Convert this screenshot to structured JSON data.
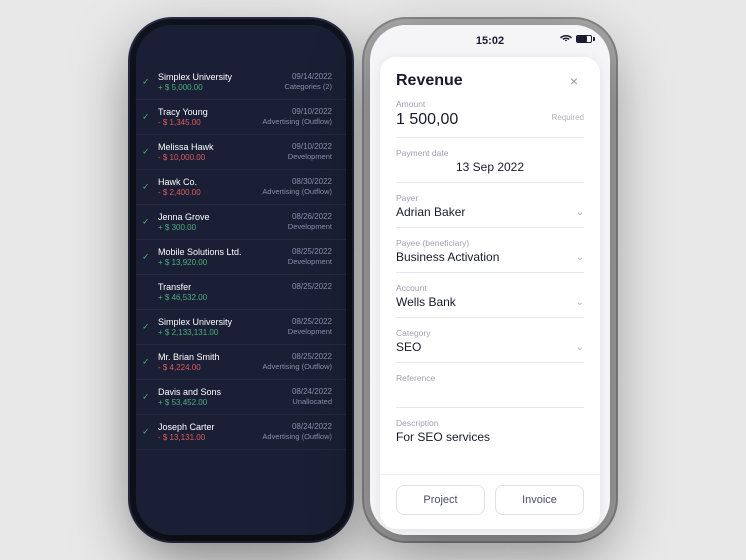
{
  "scene": {
    "bg_color": "#e0e0e4"
  },
  "left_phone": {
    "transactions": [
      {
        "name": "Simplex University",
        "amount": "+ $ 5,000.00",
        "positive": true,
        "date": "09/14/2022",
        "category": "Categories (2)",
        "checked": true
      },
      {
        "name": "Tracy Young",
        "amount": "- $ 1,345.00",
        "positive": false,
        "date": "09/10/2022",
        "category": "Advertising (Outflow)",
        "checked": true
      },
      {
        "name": "Melissa Hawk",
        "amount": "- $ 10,000.00",
        "positive": false,
        "date": "09/10/2022",
        "category": "Development",
        "checked": true
      },
      {
        "name": "Hawk Co.",
        "amount": "- $ 2,400.00",
        "positive": false,
        "date": "08/30/2022",
        "category": "Advertising (Outflow)",
        "checked": true
      },
      {
        "name": "Jenna Grove",
        "amount": "+ $ 300.00",
        "positive": true,
        "date": "08/26/2022",
        "category": "Development",
        "checked": true
      },
      {
        "name": "Mobile Solutions Ltd.",
        "amount": "+ $ 13,920.00",
        "positive": true,
        "date": "08/25/2022",
        "category": "Development",
        "checked": true
      },
      {
        "name": "Transfer",
        "amount": "+ $ 46,532.00",
        "positive": true,
        "date": "08/25/2022",
        "category": "",
        "checked": false
      },
      {
        "name": "Simplex University",
        "amount": "+ $ 2,133,131.00",
        "positive": true,
        "date": "08/25/2022",
        "category": "Development",
        "checked": true
      },
      {
        "name": "Mr. Brian Smith",
        "amount": "- $ 4,224.00",
        "positive": false,
        "date": "08/25/2022",
        "category": "Advertising (Outflow)",
        "checked": true
      },
      {
        "name": "Davis and Sons",
        "amount": "+ $ 53,452.00",
        "positive": true,
        "date": "08/24/2022",
        "category": "Unallocated",
        "checked": true
      },
      {
        "name": "Joseph Carter",
        "amount": "- $ 13,131.00",
        "positive": false,
        "date": "08/24/2022",
        "category": "Advertising (Outflow)",
        "checked": true
      }
    ]
  },
  "right_phone": {
    "status_bar": {
      "time": "15:02"
    },
    "modal": {
      "title": "Revenue",
      "close_label": "×",
      "fields": {
        "amount_label": "Amount",
        "amount_value": "1 500,00",
        "amount_required": "Required",
        "payment_date_label": "Payment date",
        "payment_date_value": "13 Sep 2022",
        "payer_label": "Payer",
        "payer_value": "Adrian Baker",
        "payee_label": "Payee (beneficiary)",
        "payee_value": "Business Activation",
        "account_label": "Account",
        "account_value": "Wells Bank",
        "category_label": "Category",
        "category_value": "SEO",
        "reference_label": "Reference",
        "reference_value": "",
        "description_label": "Description",
        "description_value": "For SEO services"
      },
      "footer": {
        "btn1": "Project",
        "btn2": "Invoice"
      }
    }
  }
}
